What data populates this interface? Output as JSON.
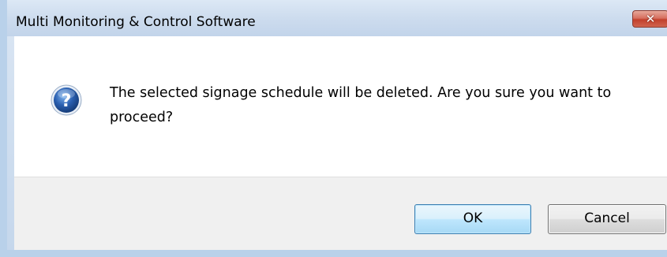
{
  "window": {
    "title": "Multi Monitoring & Control Software",
    "close_glyph": "✕"
  },
  "dialog": {
    "icon": "question-icon",
    "message": "The selected signage schedule will be deleted. Are you sure you want to proceed?"
  },
  "buttons": {
    "ok_label": "OK",
    "cancel_label": "Cancel"
  },
  "colors": {
    "frame": "#b9d1ea",
    "ok_border": "#3c7fb1",
    "close_red": "#c2402c",
    "icon_blue": "#2a5fb0"
  }
}
